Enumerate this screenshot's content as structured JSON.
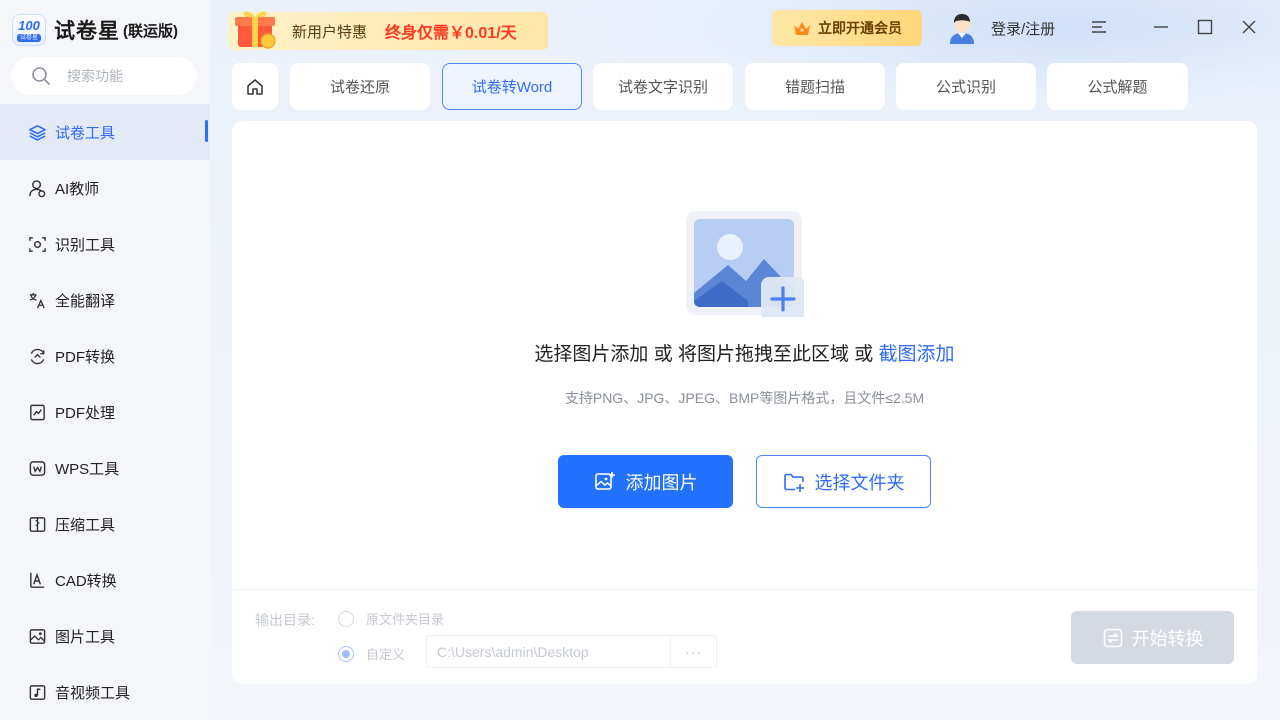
{
  "app": {
    "logo_number": "100",
    "logo_tag": "试卷星",
    "title": "试卷星",
    "edition": "(联运版)"
  },
  "search": {
    "placeholder": "搜索功能"
  },
  "sidebar": {
    "items": [
      {
        "label": "试卷工具",
        "icon": "layers-icon",
        "active": true
      },
      {
        "label": "AI教师",
        "icon": "ai-teacher-icon"
      },
      {
        "label": "识别工具",
        "icon": "scan-icon"
      },
      {
        "label": "全能翻译",
        "icon": "translate-icon"
      },
      {
        "label": "PDF转换",
        "icon": "pdf-convert-icon"
      },
      {
        "label": "PDF处理",
        "icon": "pdf-edit-icon"
      },
      {
        "label": "WPS工具",
        "icon": "wps-icon"
      },
      {
        "label": "压缩工具",
        "icon": "compress-icon"
      },
      {
        "label": "CAD转换",
        "icon": "cad-icon"
      },
      {
        "label": "图片工具",
        "icon": "image-icon"
      },
      {
        "label": "音视频工具",
        "icon": "music-icon"
      }
    ]
  },
  "promo": {
    "text": "新用户特惠",
    "price": "终身仅需￥0.01/天"
  },
  "header": {
    "vip_label": "立即开通会员",
    "login_label": "登录/注册"
  },
  "tabs": [
    {
      "label": "试卷还原"
    },
    {
      "label": "试卷转Word",
      "active": true
    },
    {
      "label": "试卷文字识别"
    },
    {
      "label": "错题扫描"
    },
    {
      "label": "公式识别"
    },
    {
      "label": "公式解题"
    }
  ],
  "upload": {
    "title_part1": "选择图片添加 或 将图片拖拽至此区域 或 ",
    "title_link": "截图添加",
    "hint": "支持PNG、JPG、JPEG、BMP等图片格式，且文件≤2.5M",
    "add_image_label": "添加图片",
    "select_folder_label": "选择文件夹"
  },
  "output": {
    "label": "输出目录:",
    "option_original": "原文件夹目录",
    "option_custom": "自定义",
    "path": "C:\\Users\\admin\\Desktop",
    "more": "···",
    "selected": "自定义"
  },
  "start_label": "开始转换",
  "colors": {
    "accent": "#2272ff",
    "active_tab_border": "#4d87ff",
    "promo_price": "#ff3a22",
    "disabled_button": "#d4d9e2"
  }
}
